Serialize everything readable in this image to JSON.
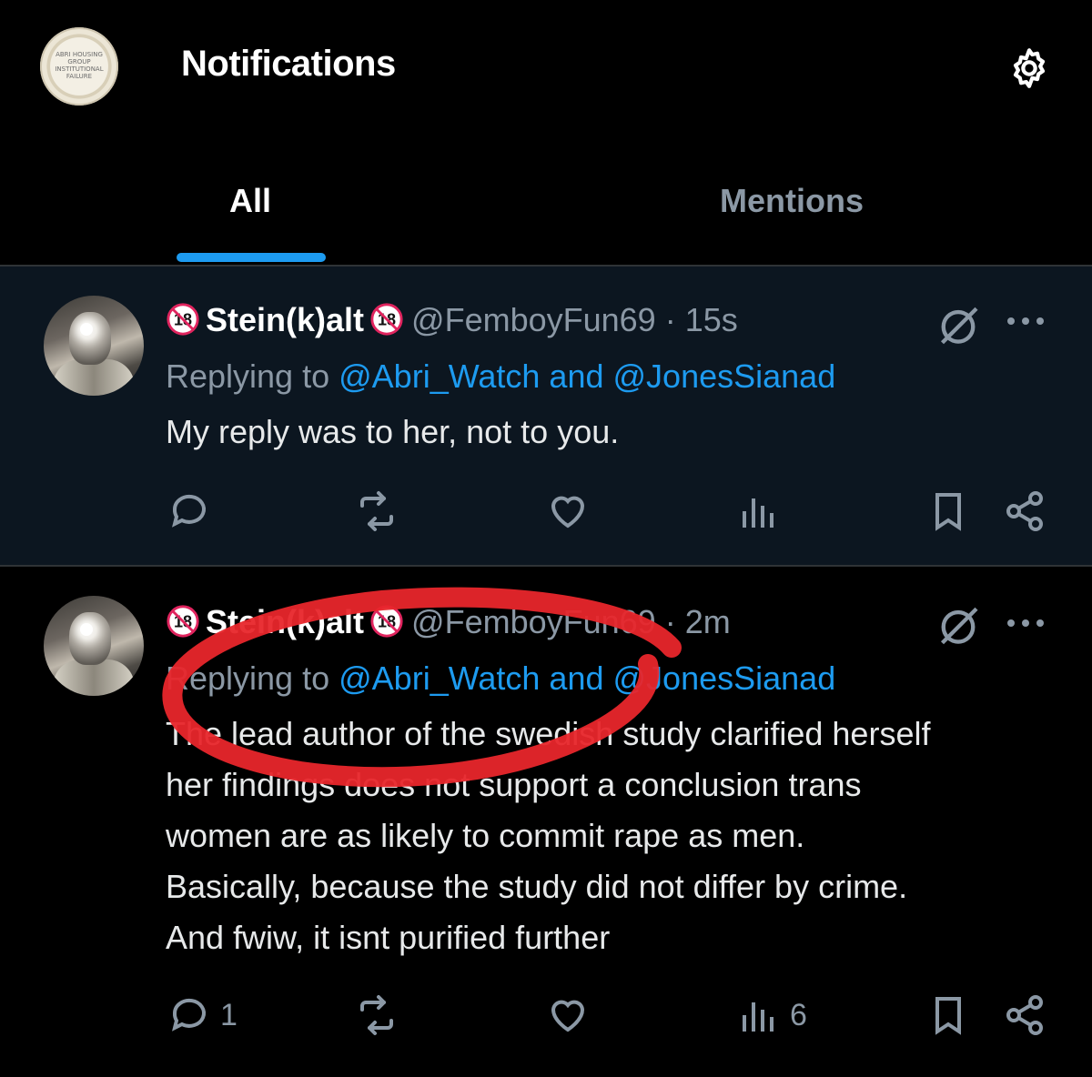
{
  "header": {
    "title": "Notifications",
    "avatar_logo_text": "ABRI HOUSING GROUP INSTITUTIONAL FAILURE"
  },
  "tabs": [
    {
      "label": "All"
    },
    {
      "label": "Mentions"
    }
  ],
  "posts": [
    {
      "display_name": "Stein(k)alt",
      "handle": "@FemboyFun69",
      "time": "· 15s",
      "replying_prefix": "Replying to",
      "reply_to_1": "@Abri_Watch",
      "reply_and": "and",
      "reply_to_2": "@JonesSianad",
      "text_lines": [
        "My reply was to her, not to you."
      ],
      "reply_count": "",
      "views": ""
    },
    {
      "display_name": "Stein(k)alt",
      "handle": "@FemboyFun69",
      "time": "· 2m",
      "replying_prefix": "Replying to",
      "reply_to_1": "@Abri_Watch",
      "reply_and": "and",
      "reply_to_2": "@JonesSianad",
      "text_lines": [
        "The lead author of the swedish study clarified herself",
        "her findings does not support a conclusion trans",
        "women are as likely to commit rape as men.",
        "Basically, because the study did not differ by crime.",
        "And fwiw, it isnt purified further"
      ],
      "reply_count": "1",
      "views": "6"
    }
  ],
  "colors": {
    "accent": "#1d9bf0",
    "muted": "#8b98a5",
    "highlight_bg": "#0c1620",
    "annotation": "#e8262b"
  },
  "icons": [
    "settings-gear-icon",
    "adult-18-icon",
    "muted-icon",
    "more-icon",
    "reply-icon",
    "repost-icon",
    "like-icon",
    "views-icon",
    "bookmark-icon",
    "share-icon"
  ]
}
